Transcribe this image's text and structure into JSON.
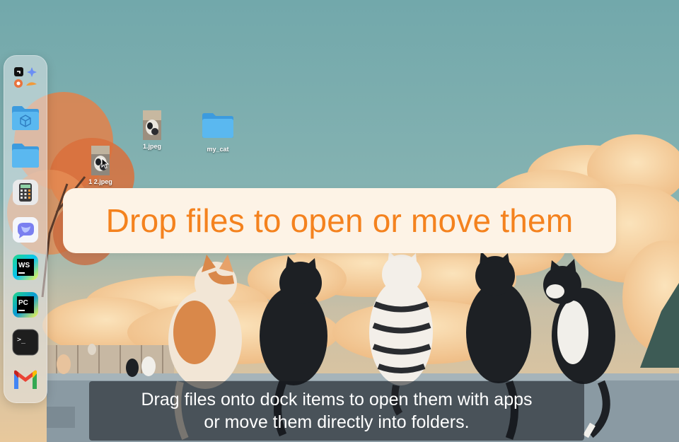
{
  "desktop": {
    "icons": [
      {
        "label": "1.jpeg"
      },
      {
        "label": "my_cat"
      },
      {
        "label": "1 2.jpeg"
      }
    ]
  },
  "dock": {
    "items": [
      "app-launcher-group",
      "folder-app-icon",
      "folder-icon",
      "calculator-icon",
      "chat-app-icon",
      "webstorm-icon",
      "pycharm-icon",
      "terminal-icon",
      "gmail-icon"
    ],
    "webstorm_text": "WS",
    "pycharm_text": "PC",
    "terminal_text": ">_"
  },
  "overlay": {
    "banner": "Drop files to open or move them",
    "caption_line1": "Drag files onto dock items to open them with apps",
    "caption_line2": "or move them directly into folders."
  },
  "colors": {
    "banner_text": "#f4821e",
    "banner_bg": "#fdf3e6",
    "folder_blue": "#5ab8f0"
  }
}
